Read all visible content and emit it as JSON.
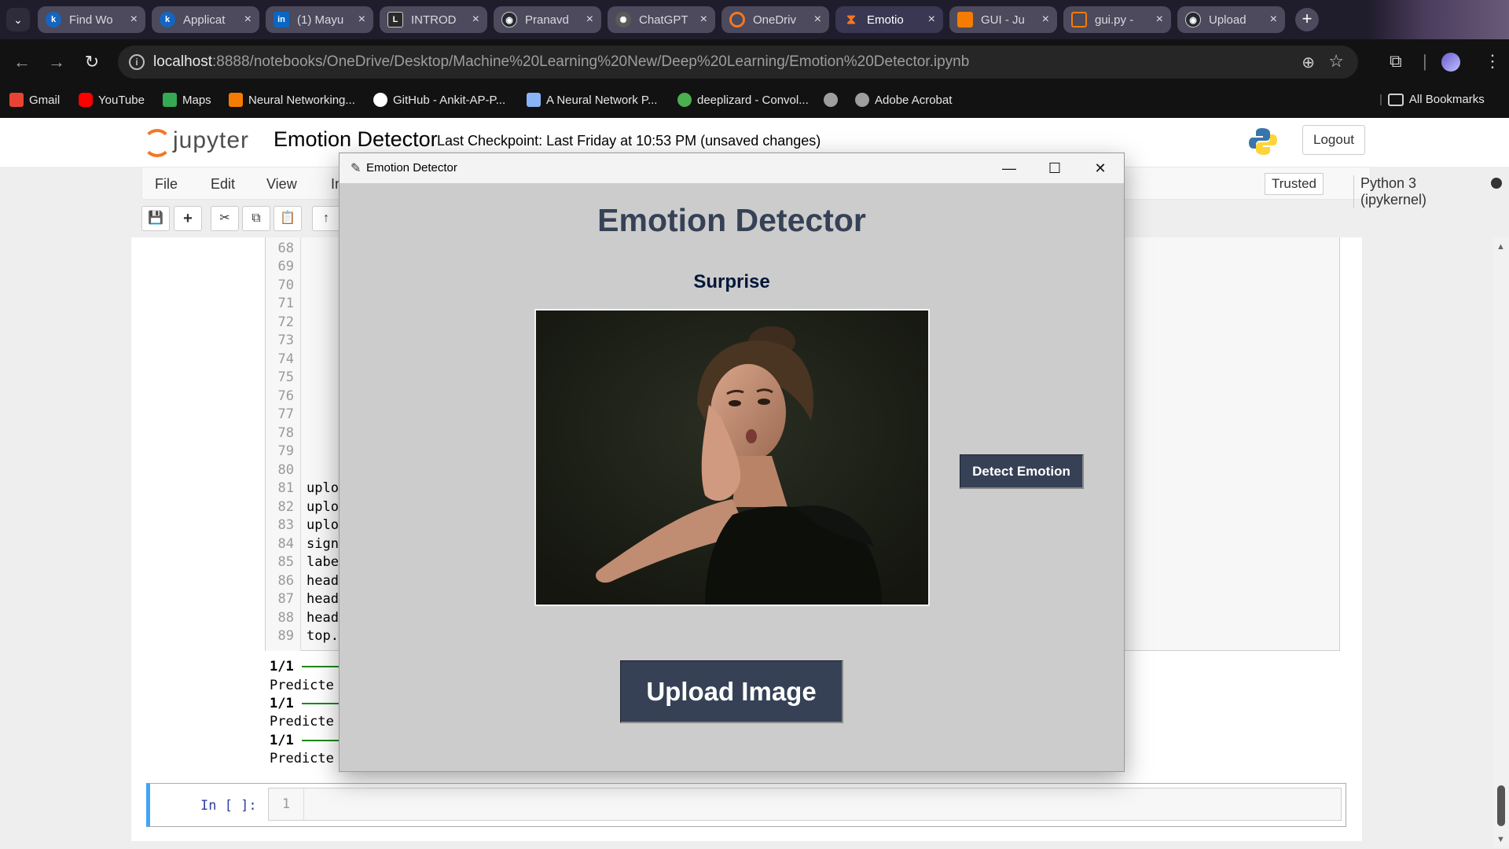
{
  "browser": {
    "tabs": [
      {
        "label": "Find Wo",
        "favicon_color": "#1565c0",
        "favicon": "k"
      },
      {
        "label": "Applicat",
        "favicon_color": "#1565c0",
        "favicon": "k"
      },
      {
        "label": "(1) Mayu",
        "favicon_color": "#0a66c2",
        "favicon": "in"
      },
      {
        "label": "INTROD",
        "favicon_color": "#4a4a4a",
        "favicon": "L"
      },
      {
        "label": "Pranavd",
        "favicon_color": "#24292f",
        "favicon": "gh"
      },
      {
        "label": "ChatGPT",
        "favicon_color": "#5a5a5a",
        "favicon": "gpt"
      },
      {
        "label": "OneDriv",
        "favicon_color": "#f37726",
        "favicon": "jp"
      },
      {
        "label": "Emotio",
        "favicon_color": "#f37726",
        "favicon": "hg"
      },
      {
        "label": "GUI - Ju",
        "favicon_color": "#f57c00",
        "favicon": "doc"
      },
      {
        "label": "gui.py -",
        "favicon_color": "#f57c00",
        "favicon": "doc"
      },
      {
        "label": "Upload",
        "favicon_color": "#24292f",
        "favicon": "gh"
      }
    ],
    "tab_close": "×",
    "new_tab": "+",
    "tab_menu": "⌄",
    "url_host": "localhost",
    "url_path": ":8888/notebooks/OneDrive/Desktop/Machine%20Learning%20New/Deep%20Learning/Emotion%20Detector.ipynb",
    "nav": {
      "back": "←",
      "forward": "→",
      "reload": "↻"
    },
    "url_icons": {
      "zoom": "⊕",
      "star": "☆",
      "info": "i"
    },
    "right_icons": {
      "extensions": "⧉",
      "menu": "⋮"
    },
    "bookmarks": [
      {
        "label": "Gmail",
        "color": "#ea4335"
      },
      {
        "label": "YouTube",
        "color": "#ff0000"
      },
      {
        "label": "Maps",
        "color": "#34a853"
      },
      {
        "label": "Neural Networking...",
        "color": "#f57c00"
      },
      {
        "label": "GitHub - Ankit-AP-P...",
        "color": "#ffffff"
      },
      {
        "label": "A Neural Network P...",
        "color": "#8ab4f8"
      },
      {
        "label": "deeplizard - Convol...",
        "color": "#4caf50"
      },
      {
        "label": "",
        "color": "#9e9e9e"
      },
      {
        "label": "Adobe Acrobat",
        "color": "#9e9e9e"
      }
    ],
    "all_bookmarks": "All Bookmarks"
  },
  "jupyter": {
    "logo_word": "jupyter",
    "notebook_title": "Emotion Detector",
    "checkpoint": "Last Checkpoint: Last Friday at 10:53 PM   (unsaved changes)",
    "logout": "Logout",
    "menus": [
      "File",
      "Edit",
      "View",
      "In"
    ],
    "trusted": "Trusted",
    "kernel": "Python 3 (ipykernel)",
    "toolbar_icons": [
      "💾",
      "+",
      "✂",
      "⧉",
      "📋",
      "↑"
    ],
    "line_numbers": [
      "68",
      "69",
      "70",
      "71",
      "72",
      "73",
      "74",
      "75",
      "76",
      "77",
      "78",
      "79",
      "80",
      "81",
      "82",
      "83",
      "84",
      "85",
      "86",
      "87",
      "88",
      "89"
    ],
    "code_lines": [
      "",
      "",
      "",
      "",
      "",
      "",
      "",
      "",
      "",
      "",
      "",
      "",
      "",
      "uplo",
      "uplo",
      "uplo",
      "sign",
      "labe",
      "head",
      "head",
      "head",
      "top."
    ],
    "output_lines": [
      {
        "text": "1/1",
        "bar": true
      },
      {
        "text": "Predicte",
        "bar": false
      },
      {
        "text": "1/1",
        "bar": true
      },
      {
        "text": "Predicte",
        "bar": false
      },
      {
        "text": "1/1",
        "bar": true
      },
      {
        "text": "Predicte",
        "bar": false
      }
    ],
    "in_prompt": "In [ ]:",
    "in_line_number": "1"
  },
  "dialog": {
    "title": "Emotion Detector",
    "controls": {
      "minimize": "—",
      "maximize": "☐",
      "close": "✕"
    },
    "heading": "Emotion Detector",
    "result": "Surprise",
    "detect_button": "Detect Emotion",
    "upload_button": "Upload Image",
    "colors": {
      "bg": "#cccccc",
      "heading": "#364156",
      "result": "#011638",
      "button_bg": "#364156",
      "button_fg": "#ffffff"
    }
  }
}
